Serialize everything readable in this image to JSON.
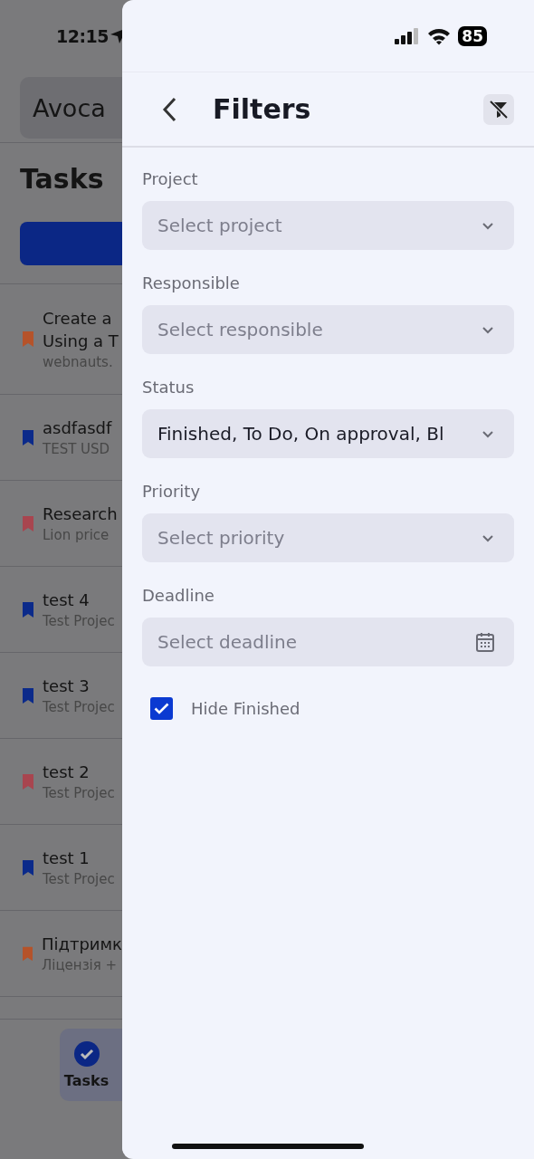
{
  "status_bar": {
    "time": "12:15",
    "battery": "85"
  },
  "background": {
    "workspace": "Avoca",
    "title": "Tasks",
    "tasks": [
      {
        "lines": [
          "Create a",
          "Using a T"
        ],
        "subtitle": "webnauts.",
        "color": "#b5532a"
      },
      {
        "lines": [
          "asdfasdf"
        ],
        "subtitle": "TEST USD",
        "color": "#0b2a8a"
      },
      {
        "lines": [
          "Research"
        ],
        "subtitle": "Lion price",
        "color": "#a8454f"
      },
      {
        "lines": [
          "test 4"
        ],
        "subtitle": "Test Projec",
        "color": "#0b2a8a"
      },
      {
        "lines": [
          "test 3"
        ],
        "subtitle": "Test Projec",
        "color": "#0b2a8a"
      },
      {
        "lines": [
          "test 2"
        ],
        "subtitle": "Test Projec",
        "color": "#a8454f"
      },
      {
        "lines": [
          "test 1"
        ],
        "subtitle": "Test Projec",
        "color": "#0b2a8a"
      },
      {
        "lines": [
          "Підтримк"
        ],
        "subtitle": "Ліцензія +",
        "color": "#b5532a"
      }
    ],
    "nav": [
      {
        "label": "Tasks",
        "selected": true
      }
    ]
  },
  "filters": {
    "title": "Filters",
    "fields": [
      {
        "label": "Project",
        "kind": "select",
        "placeholder": "Select project"
      },
      {
        "label": "Responsible",
        "kind": "select",
        "placeholder": "Select responsible"
      },
      {
        "label": "Status",
        "kind": "select",
        "value": "Finished, To Do, On approval, Bl"
      },
      {
        "label": "Priority",
        "kind": "select",
        "placeholder": "Select priority"
      },
      {
        "label": "Deadline",
        "kind": "date",
        "placeholder": "Select deadline"
      }
    ],
    "hide_finished": {
      "label": "Hide Finished",
      "checked": true
    }
  }
}
